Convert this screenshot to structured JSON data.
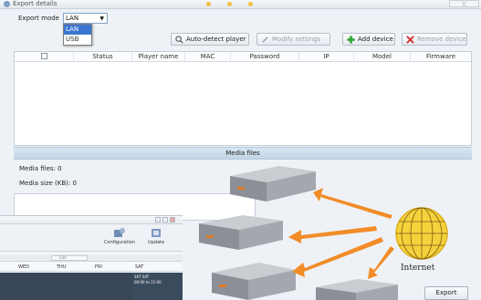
{
  "window": {
    "title": "Export details"
  },
  "toolbar": {
    "mode_label": "Export mode",
    "mode_value": "LAN",
    "mode_options": [
      "LAN",
      "USB"
    ],
    "buttons": {
      "autodetect": "Auto-detect player",
      "modify": "Modify settings",
      "add": "Add device",
      "remove": "Remove device"
    }
  },
  "table": {
    "columns": [
      "",
      "Status",
      "Player name",
      "MAC",
      "Password",
      "IP",
      "Model",
      "Firmware"
    ]
  },
  "media": {
    "section_title": "Media files",
    "files_label": "Media files: 0",
    "size_label": "Media size (KB): 0"
  },
  "second_window": {
    "config_label": "Configuration",
    "update_label": "Update",
    "edit_label": "Edit",
    "days": [
      "WED",
      "THU",
      "FRI",
      "SAT"
    ],
    "cell_lines": [
      "SAT SAT",
      "00:00 to 11:00"
    ]
  },
  "illustration": {
    "internet_label": "Internet",
    "colors": {
      "arrow": "#f28c28",
      "globe": "#f5d23c"
    }
  },
  "footer": {
    "export_label": "Export"
  },
  "colors": {
    "accent": "#3a76d1",
    "header_band": "#c9d9ea",
    "add_icon": "#2fa836",
    "remove_icon": "#d22b2b"
  }
}
